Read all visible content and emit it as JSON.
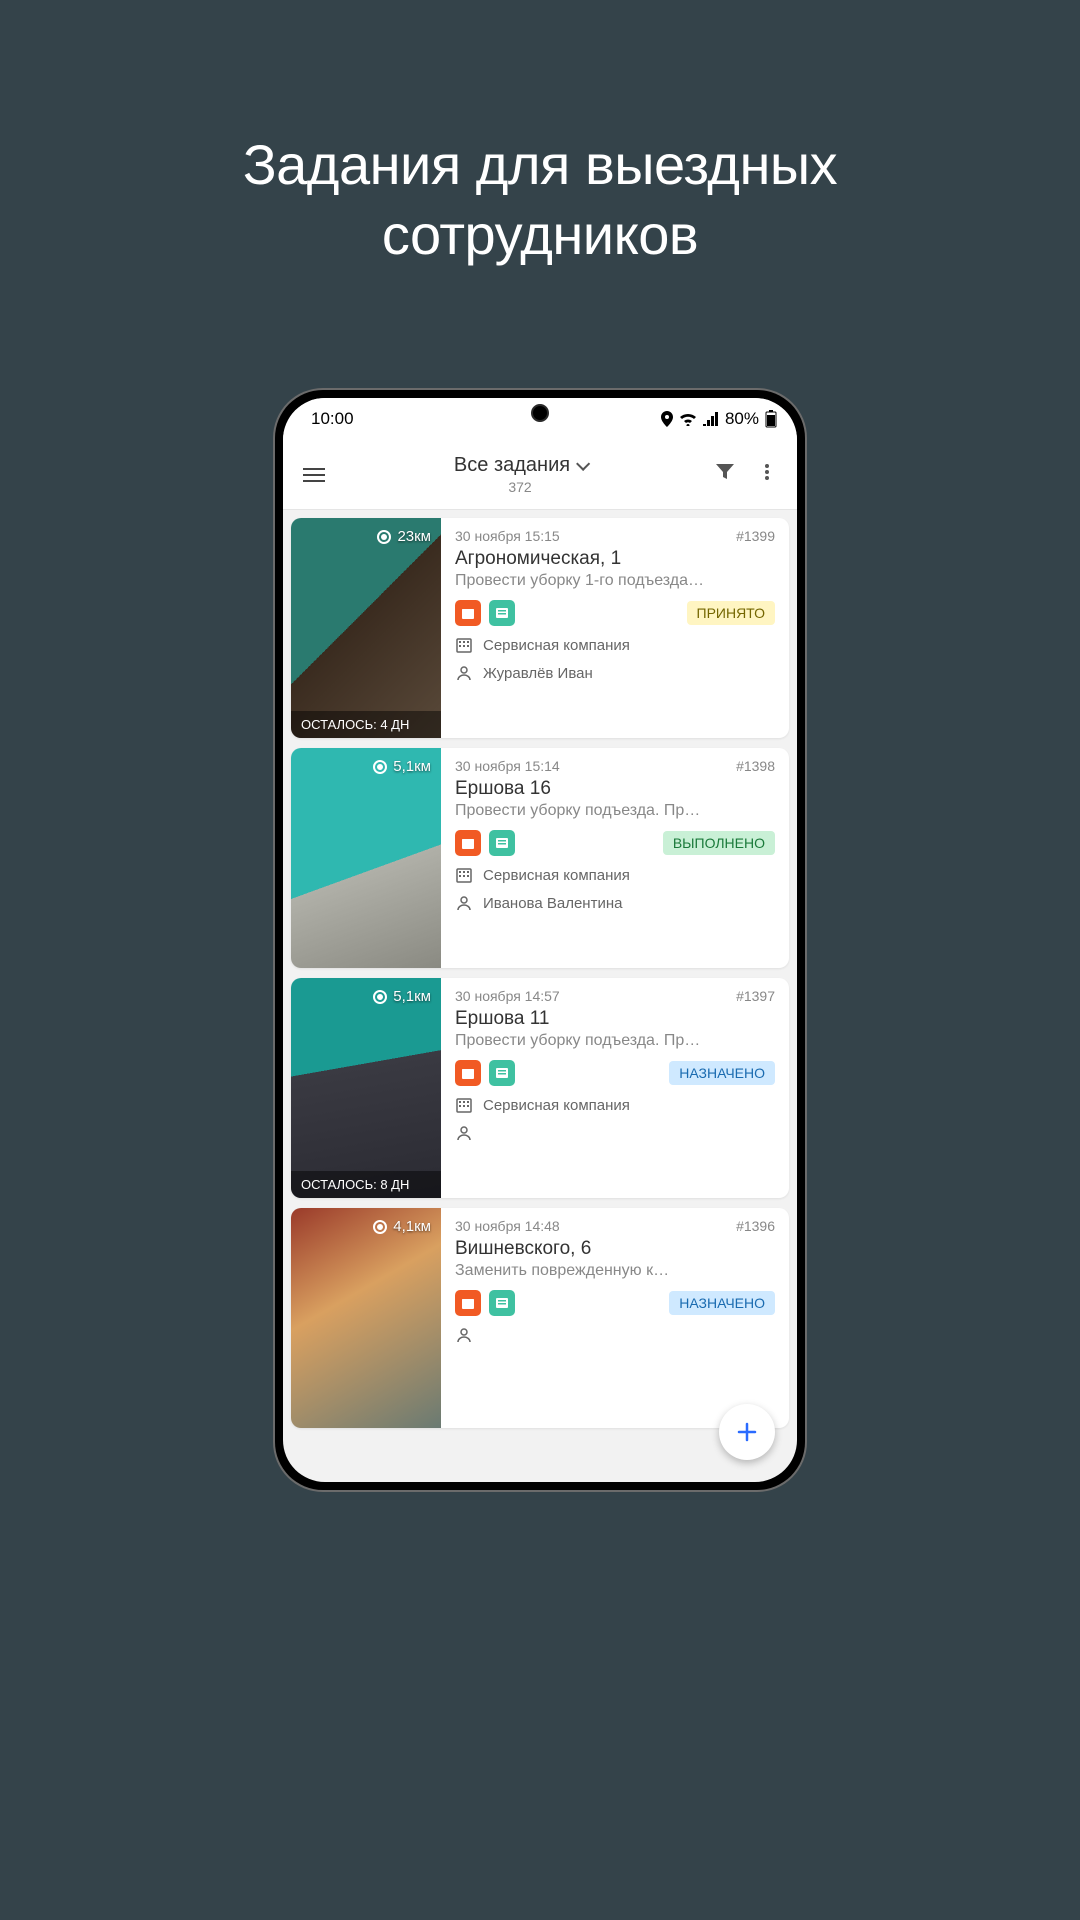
{
  "promo": {
    "title_line1": "Задания для выездных",
    "title_line2": "сотрудников"
  },
  "statusbar": {
    "time": "10:00",
    "battery": "80%"
  },
  "appbar": {
    "title": "Все задания",
    "count": "372"
  },
  "tasks": [
    {
      "distance": "23км",
      "remaining": "ОСТАЛОСЬ: 4 ДН",
      "datetime": "30 ноября 15:15",
      "id": "#1399",
      "title": "Агрономическая, 1",
      "desc": "Провести уборку 1-го подъезда…",
      "status": "ПРИНЯТО",
      "status_class": "st-accepted",
      "company": "Сервисная компания",
      "assignee": "Журавлёв Иван",
      "thumb": "t1"
    },
    {
      "distance": "5,1км",
      "remaining": "",
      "datetime": "30 ноября 15:14",
      "id": "#1398",
      "title": "Ершова 16",
      "desc": "Провести уборку подъезда. Пр…",
      "status": "ВЫПОЛНЕНО",
      "status_class": "st-done",
      "company": "Сервисная компания",
      "assignee": "Иванова Валентина",
      "thumb": "t2"
    },
    {
      "distance": "5,1км",
      "remaining": "ОСТАЛОСЬ: 8 ДН",
      "datetime": "30 ноября 14:57",
      "id": "#1397",
      "title": "Ершова 11",
      "desc": "Провести уборку подъезда. Пр…",
      "status": "НАЗНАЧЕНО",
      "status_class": "st-assigned",
      "company": "Сервисная компания",
      "assignee": "",
      "thumb": "t3"
    },
    {
      "distance": "4,1км",
      "remaining": "",
      "datetime": "30 ноября 14:48",
      "id": "#1396",
      "title": "Вишневского, 6",
      "desc": "Заменить поврежденную к…",
      "status": "НАЗНАЧЕНО",
      "status_class": "st-assigned",
      "company": "",
      "assignee": "",
      "thumb": "t4"
    }
  ]
}
